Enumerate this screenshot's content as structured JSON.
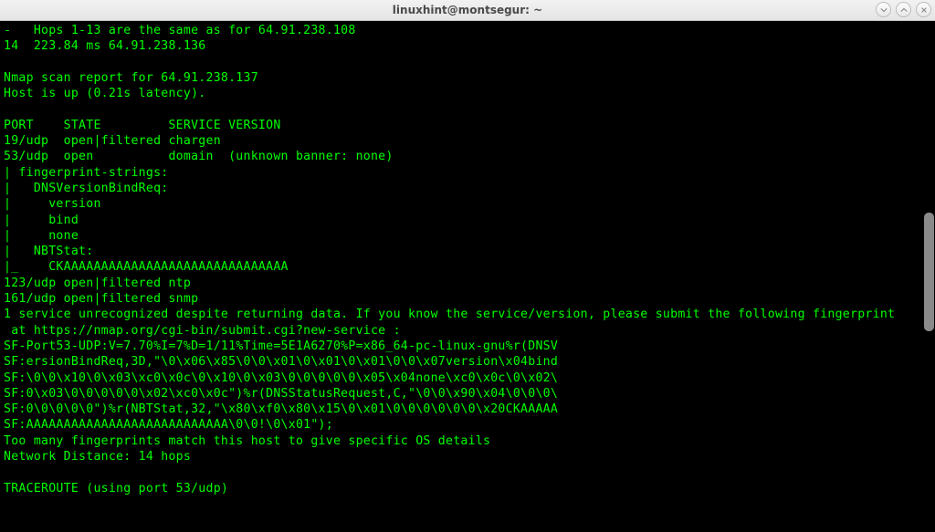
{
  "window": {
    "title": "linuxhint@montsegur: ~"
  },
  "terminal": {
    "lines": [
      "-   Hops 1-13 are the same as for 64.91.238.108",
      "14  223.84 ms 64.91.238.136",
      "",
      "Nmap scan report for 64.91.238.137",
      "Host is up (0.21s latency).",
      "",
      "PORT    STATE         SERVICE VERSION",
      "19/udp  open|filtered chargen",
      "53/udp  open          domain  (unknown banner: none)",
      "| fingerprint-strings:",
      "|   DNSVersionBindReq:",
      "|     version",
      "|     bind",
      "|     none",
      "|   NBTStat:",
      "|_    CKAAAAAAAAAAAAAAAAAAAAAAAAAAAAAA",
      "123/udp open|filtered ntp",
      "161/udp open|filtered snmp",
      "1 service unrecognized despite returning data. If you know the service/version, please submit the following fingerprint",
      " at https://nmap.org/cgi-bin/submit.cgi?new-service :",
      "SF-Port53-UDP:V=7.70%I=7%D=1/11%Time=5E1A6270%P=x86_64-pc-linux-gnu%r(DNSV",
      "SF:ersionBindReq,3D,\"\\0\\x06\\x85\\0\\0\\x01\\0\\x01\\0\\x01\\0\\0\\x07version\\x04bind",
      "SF:\\0\\0\\x10\\0\\x03\\xc0\\x0c\\0\\x10\\0\\x03\\0\\0\\0\\0\\0\\x05\\x04none\\xc0\\x0c\\0\\x02\\",
      "SF:0\\x03\\0\\0\\0\\0\\0\\x02\\xc0\\x0c\")%r(DNSStatusRequest,C,\"\\0\\0\\x90\\x04\\0\\0\\0\\",
      "SF:0\\0\\0\\0\\0\")%r(NBTStat,32,\"\\x80\\xf0\\x80\\x15\\0\\x01\\0\\0\\0\\0\\0\\0\\x20CKAAAAA",
      "SF:AAAAAAAAAAAAAAAAAAAAAAAAAAA\\0\\0!\\0\\x01\");",
      "Too many fingerprints match this host to give specific OS details",
      "Network Distance: 14 hops",
      "",
      "TRACEROUTE (using port 53/udp)"
    ]
  }
}
